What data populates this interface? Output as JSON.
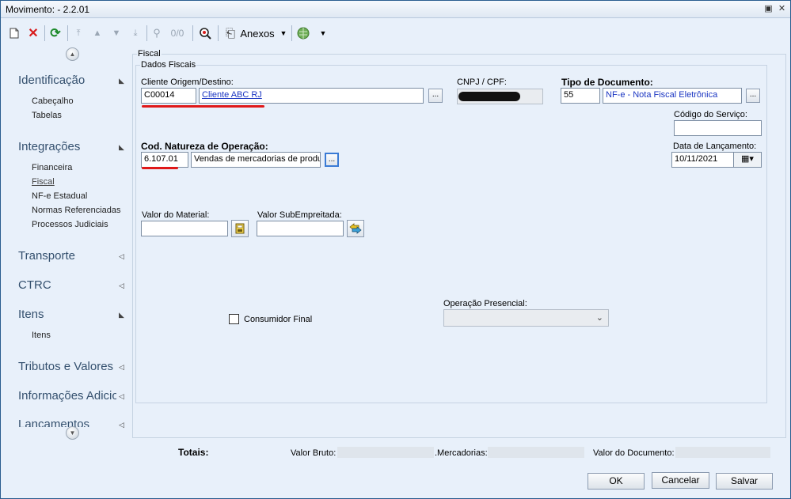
{
  "window": {
    "title": "Movimento:  - 2.2.01"
  },
  "toolbar": {
    "record_pos": "0/0",
    "anexos_label": "Anexos"
  },
  "sidebar": {
    "sections": [
      {
        "label": "Identificação",
        "items": [
          "Cabeçalho",
          "Tabelas"
        ]
      },
      {
        "label": "Integrações",
        "items": [
          "Financeira",
          "Fiscal",
          "NF-e Estadual",
          "Normas Referenciadas",
          "Processos Judiciais"
        ]
      },
      {
        "label": "Transporte",
        "items": []
      },
      {
        "label": "CTRC",
        "items": []
      },
      {
        "label": "Itens",
        "items": [
          "Itens"
        ]
      },
      {
        "label": "Tributos e Valores",
        "items": []
      },
      {
        "label": "Informações Adicio",
        "items": []
      },
      {
        "label": "Lancamentos",
        "items": []
      }
    ],
    "active_item": "Fiscal"
  },
  "form": {
    "group_outer": "Fiscal",
    "group_inner": "Dados Fiscais",
    "cliente_label": "Cliente Origem/Destino:",
    "cliente_code": "C00014",
    "cliente_name": "Cliente ABC RJ",
    "cnpj_label": "CNPJ / CPF:",
    "tipo_doc_label": "Tipo de Documento:",
    "tipo_doc_code": "55",
    "tipo_doc_name": "NF-e - Nota Fiscal Eletrônica",
    "codigo_servico_label": "Código do Serviço:",
    "codigo_servico_value": "",
    "natureza_label": "Cod. Natureza de Operação:",
    "natureza_code": "6.107.01",
    "natureza_desc": "Vendas de mercadorias de produ",
    "data_lanc_label": "Data de Lançamento:",
    "data_lanc_value": "10/11/2021",
    "valor_material_label": "Valor do Material:",
    "valor_material_value": "",
    "valor_sub_label": "Valor SubEmpreitada:",
    "valor_sub_value": "",
    "consumidor_final_label": "Consumidor Final",
    "operacao_presencial_label": "Operação Presencial:",
    "dots": "..."
  },
  "footer": {
    "totais_label": "Totais:",
    "valor_bruto_label": "Valor Bruto:",
    "mercadorias_label": ".Mercadorias:",
    "valor_documento_label": "Valor do Documento:",
    "ok_label": "OK",
    "cancelar_label": "Cancelar",
    "salvar_label": "Salvar"
  },
  "colors": {
    "accent_red": "#e01818",
    "link_blue": "#1a35c2",
    "sidebar_heading": "#34506e"
  }
}
